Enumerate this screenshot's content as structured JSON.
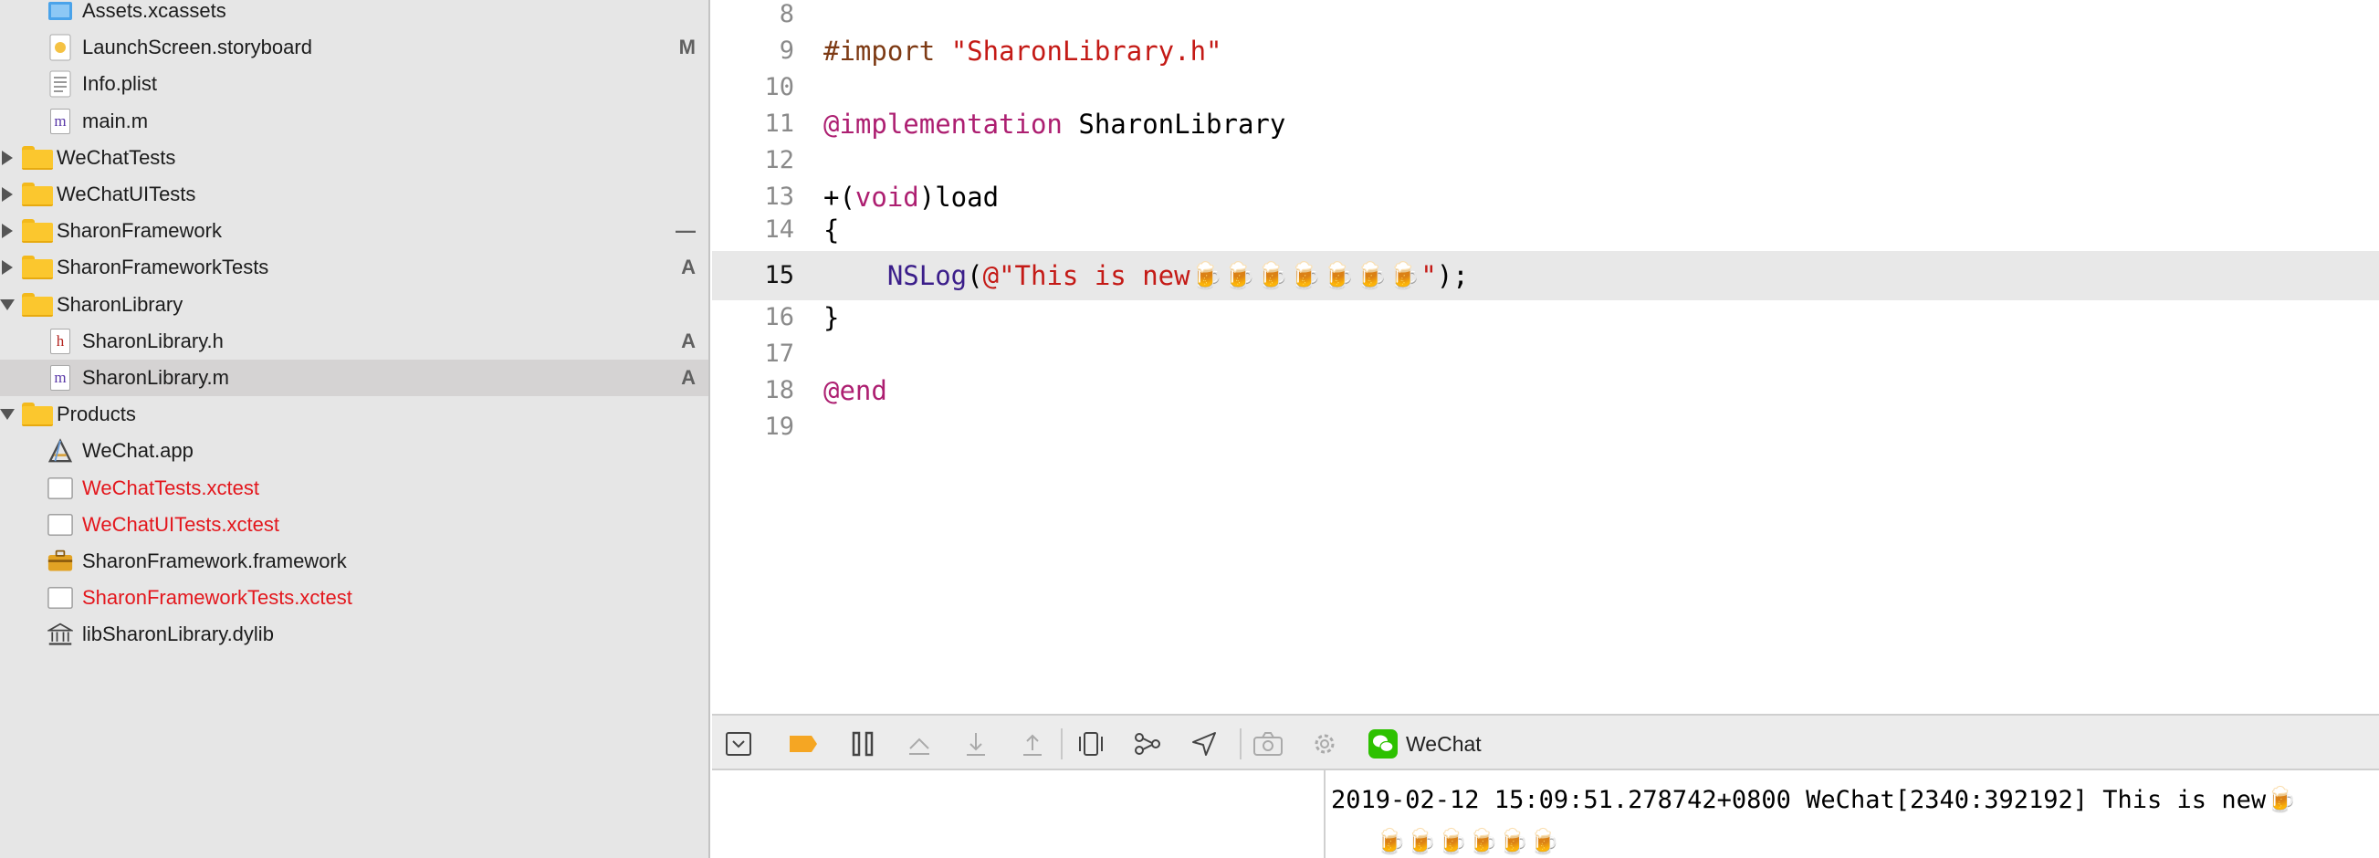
{
  "navigator": {
    "items": [
      {
        "label": "Assets.xcassets",
        "badge": "",
        "kind": "assets"
      },
      {
        "label": "LaunchScreen.storyboard",
        "badge": "M",
        "kind": "storyboard"
      },
      {
        "label": "Info.plist",
        "badge": "",
        "kind": "plist"
      },
      {
        "label": "main.m",
        "badge": "",
        "kind": "m",
        "glyph": "m"
      },
      {
        "label": "WeChatTests",
        "badge": "",
        "kind": "folder"
      },
      {
        "label": "WeChatUITests",
        "badge": "",
        "kind": "folder"
      },
      {
        "label": "SharonFramework",
        "badge": "—",
        "kind": "folder"
      },
      {
        "label": "SharonFrameworkTests",
        "badge": "A",
        "kind": "folder"
      },
      {
        "label": "SharonLibrary",
        "badge": "",
        "kind": "folder-open"
      },
      {
        "label": "SharonLibrary.h",
        "badge": "A",
        "kind": "h",
        "glyph": "h"
      },
      {
        "label": "SharonLibrary.m",
        "badge": "A",
        "kind": "m",
        "glyph": "m"
      },
      {
        "label": "Products",
        "badge": "",
        "kind": "folder-open"
      },
      {
        "label": "WeChat.app",
        "badge": "",
        "kind": "app"
      },
      {
        "label": "WeChatTests.xctest",
        "badge": "",
        "kind": "xctest",
        "missing": true
      },
      {
        "label": "WeChatUITests.xctest",
        "badge": "",
        "kind": "xctest",
        "missing": true
      },
      {
        "label": "SharonFramework.framework",
        "badge": "",
        "kind": "framework"
      },
      {
        "label": "SharonFrameworkTests.xctest",
        "badge": "",
        "kind": "xctest",
        "missing": true
      },
      {
        "label": "libSharonLibrary.dylib",
        "badge": "",
        "kind": "dylib"
      }
    ]
  },
  "editor": {
    "current_line": "15",
    "lines": [
      {
        "n": "8",
        "t": [
          [
            "pl",
            ""
          ]
        ]
      },
      {
        "n": "9",
        "t": [
          [
            "pp",
            "#import "
          ],
          [
            "str",
            "\"SharonLibrary.h\""
          ]
        ]
      },
      {
        "n": "10",
        "t": [
          [
            "pl",
            ""
          ]
        ]
      },
      {
        "n": "11",
        "t": [
          [
            "kw",
            "@implementation"
          ],
          [
            "pl",
            " SharonLibrary"
          ]
        ]
      },
      {
        "n": "12",
        "t": [
          [
            "pl",
            ""
          ]
        ]
      },
      {
        "n": "13",
        "t": [
          [
            "pl",
            "+("
          ],
          [
            "kw",
            "void"
          ],
          [
            "pl",
            ")load"
          ]
        ]
      },
      {
        "n": "14",
        "t": [
          [
            "pl",
            "{"
          ]
        ]
      },
      {
        "n": "15",
        "t": [
          [
            "pl",
            "    "
          ],
          [
            "fn",
            "NSLog"
          ],
          [
            "pl",
            "("
          ],
          [
            "str",
            "@\"This is new🍺🍺🍺🍺🍺🍺🍺\""
          ],
          [
            "pl",
            ");"
          ]
        ]
      },
      {
        "n": "16",
        "t": [
          [
            "pl",
            "}"
          ]
        ]
      },
      {
        "n": "17",
        "t": [
          [
            "pl",
            ""
          ]
        ]
      },
      {
        "n": "18",
        "t": [
          [
            "kw",
            "@end"
          ]
        ]
      },
      {
        "n": "19",
        "t": [
          [
            "pl",
            ""
          ]
        ]
      }
    ]
  },
  "debug_bar": {
    "app_name": "WeChat",
    "icons": [
      "hide-debug-area-icon",
      "breakpoints-toggle-icon",
      "pause-icon",
      "step-over-icon",
      "step-into-icon",
      "step-out-icon",
      "view-hierarchy-icon",
      "memory-graph-icon",
      "simulate-location-icon",
      "camera-icon",
      "gear-icon",
      "wechat-app-icon"
    ]
  },
  "console": {
    "text": "2019-02-12 15:09:51.278742+0800 WeChat[2340:392192] This is new🍺\n   🍺🍺🍺🍺🍺🍺"
  },
  "colors": {
    "keyword": "#ad1f71",
    "string": "#c41a16",
    "missing_file": "#e3171d",
    "breakpoint": "#f5a623",
    "wechat_green": "#2dc100"
  }
}
